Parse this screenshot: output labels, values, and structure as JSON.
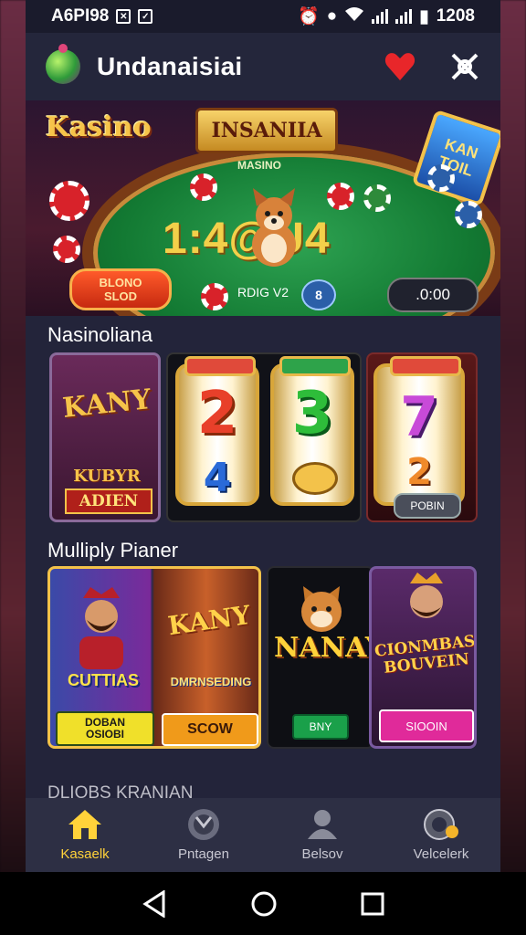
{
  "status_bar": {
    "left_text": "A6PI98",
    "right_text": "1208"
  },
  "app": {
    "title": "Undanaisiai"
  },
  "banner": {
    "brand": "Kasino",
    "sign": "INSANIIA",
    "side_sign": "KAN TOIL",
    "table_label": "MASINO",
    "jackpot": "1:4@U4",
    "left_button_line1": "BLONO",
    "left_button_line2": "SLOD",
    "mid_text": "RDIG V2",
    "coin_label": "8",
    "right_button": ".0:00"
  },
  "section1": {
    "title": "Nasinoliana",
    "games": {
      "a_title": "KANY",
      "a_sub": "KUBYR",
      "a_badge": "ADIEN",
      "b_reel1_top": "2",
      "b_reel1_bottom": "4",
      "b_reel2_top": "3",
      "c_reel_top": "7",
      "c_reel_bottom": "2",
      "c_button": "POBIN"
    }
  },
  "section2": {
    "title": "Mulliply Pianer",
    "games": {
      "d_left_title": "CUTTIAS",
      "d_left_btn_line1": "DOBAN",
      "d_left_btn_line2": "OSIOBI",
      "d_right_title": "KANY",
      "d_right_sub": "DMRNSEDING",
      "d_right_btn": "SCOW",
      "e_title": "NANAY",
      "e_btn": "BNY",
      "f_title_line1": "CIONMBAS",
      "f_title_line2": "BOUVEIN",
      "f_btn": "SIOOIN"
    }
  },
  "section3": {
    "title": "DLIOBS KRANIAN"
  },
  "bottom_nav": {
    "items": [
      {
        "label": "Kasaelk",
        "icon": "home-icon",
        "active": true
      },
      {
        "label": "Pntagen",
        "icon": "target-icon",
        "active": false
      },
      {
        "label": "Belsov",
        "icon": "user-icon",
        "active": false
      },
      {
        "label": "Velcelerk",
        "icon": "wallet-icon",
        "active": false
      }
    ]
  },
  "colors": {
    "accent": "#ffd23a",
    "app_bg": "#23243a",
    "nav_bg": "#2d2f44"
  }
}
